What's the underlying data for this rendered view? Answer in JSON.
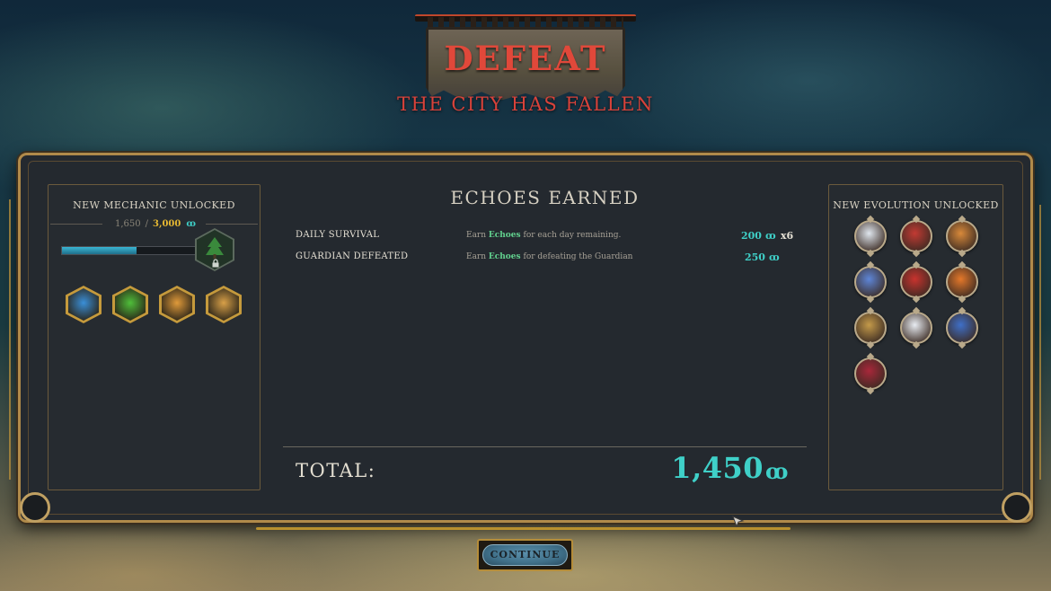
{
  "header": {
    "title": "DEFEAT",
    "subtitle": "THE CITY HAS FALLEN"
  },
  "left_panel": {
    "heading": "NEW MECHANIC UNLOCKED",
    "progress_current": "1,650",
    "progress_separator": "/",
    "progress_target": "3,000",
    "progress_fraction": 0.55,
    "currency_glyph": "ꝏ",
    "locked_icon": "tree-icon",
    "mechanics": [
      {
        "icon": "crystal-icon",
        "color": "#3a8fd8"
      },
      {
        "icon": "potion-icon",
        "color": "#4fbf3a"
      },
      {
        "icon": "spark-icon",
        "color": "#e09a3a"
      },
      {
        "icon": "fist-icon",
        "color": "#d8a048"
      }
    ]
  },
  "center": {
    "title": "ECHOES EARNED",
    "rows": [
      {
        "label": "DAILY SURVIVAL",
        "desc_prefix": "Earn",
        "desc_highlight": "Echoes",
        "desc_suffix": "for each day remaining.",
        "value": "200",
        "multiplier": "x6"
      },
      {
        "label": "GUARDIAN DEFEATED",
        "desc_prefix": "Earn",
        "desc_highlight": "Echoes",
        "desc_suffix": "for defeating the Guardian",
        "value": "250",
        "multiplier": ""
      }
    ],
    "total_label": "TOTAL:",
    "total_value": "1,450"
  },
  "right_panel": {
    "heading": "NEW EVOLUTION UNLOCKED",
    "evolutions": [
      {
        "icon": "wolf-claw-icon",
        "color": "#dfe6ee"
      },
      {
        "icon": "red-feather-icon",
        "color": "#c23a33"
      },
      {
        "icon": "claw-marks-icon",
        "color": "#d8893a"
      },
      {
        "icon": "blue-diamond-icon",
        "color": "#5e86d8"
      },
      {
        "icon": "red-slash-icon",
        "color": "#c8332e"
      },
      {
        "icon": "fire-swirl-icon",
        "color": "#e4782a"
      },
      {
        "icon": "eye-icon",
        "color": "#c49a4a"
      },
      {
        "icon": "white-burst-icon",
        "color": "#e8ecf2"
      },
      {
        "icon": "blue-boot-icon",
        "color": "#3f6fc8"
      },
      {
        "icon": "red-cloak-icon",
        "color": "#a8283a"
      }
    ]
  },
  "actions": {
    "continue_label": "CONTINUE"
  },
  "colors": {
    "defeat_red": "#e0483a",
    "echo_teal": "#3fd0c8",
    "gold_frame": "#b08a4a",
    "target_gold": "#e4b732",
    "highlight_green": "#62d28f"
  }
}
